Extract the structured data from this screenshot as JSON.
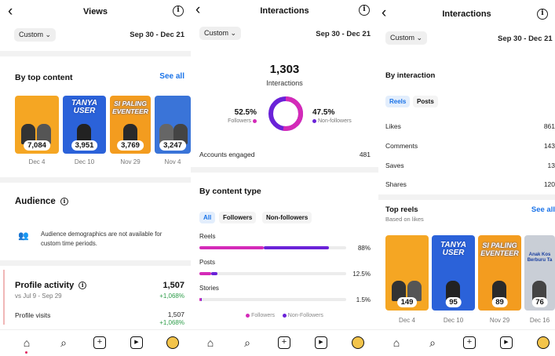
{
  "colors": {
    "followers": "#d42ab8",
    "non_followers": "#6a22d8",
    "accent": "#1a73e8",
    "green": "#2e9d4a"
  },
  "views": {
    "title": "Views",
    "filter": "Custom",
    "date_range": "Sep 30 - Dec 21",
    "top_content": {
      "heading": "By top content",
      "see_all": "See all",
      "items": [
        {
          "count": "7,084",
          "date": "Dec 4"
        },
        {
          "count": "3,951",
          "date": "Dec 10",
          "caption": "TANYA USER"
        },
        {
          "count": "3,769",
          "date": "Nov 29",
          "caption": "SI PALING EVENTEER"
        },
        {
          "count": "3,247",
          "date": "Nov 4"
        }
      ]
    },
    "audience": {
      "heading": "Audience",
      "notice": "Audience demographics are not available for custom time periods."
    },
    "profile_activity": {
      "heading": "Profile activity",
      "sub": "vs Jul 9 - Sep 29",
      "value": "1,507",
      "change": "+1,068%",
      "visits_label": "Profile visits",
      "visits_value": "1,507",
      "visits_change": "+1,068%"
    }
  },
  "interactions": {
    "title": "Interactions",
    "filter": "Custom",
    "date_range": "Sep 30 - Dec 21",
    "total": "1,303",
    "total_label": "Interactions",
    "followers_pct": "52.5%",
    "followers_label": "Followers",
    "non_followers_pct": "47.5%",
    "non_followers_label": "Non-followers",
    "followers_fraction": 0.525,
    "accounts_label": "Accounts engaged",
    "accounts_value": "481",
    "content_type": {
      "heading": "By content type",
      "tabs": [
        "All",
        "Followers",
        "Non-followers"
      ],
      "rows": [
        {
          "label": "Reels",
          "pct": "88%",
          "followers": 0.44,
          "non_followers": 0.44
        },
        {
          "label": "Posts",
          "pct": "12.5%",
          "followers": 0.08,
          "non_followers": 0.045
        },
        {
          "label": "Stories",
          "pct": "1.5%",
          "followers": 0.01,
          "non_followers": 0.005
        }
      ],
      "legend_followers": "Followers",
      "legend_non_followers": "Non-Followers"
    }
  },
  "interactions2": {
    "title": "Interactions",
    "filter": "Custom",
    "date_range": "Sep 30 - Dec 21",
    "by_interaction": {
      "heading": "By interaction",
      "tabs": [
        "Reels",
        "Posts"
      ],
      "rows": [
        {
          "label": "Likes",
          "value": "861"
        },
        {
          "label": "Comments",
          "value": "143"
        },
        {
          "label": "Saves",
          "value": "13"
        },
        {
          "label": "Shares",
          "value": "120"
        }
      ]
    },
    "top_reels": {
      "heading": "Top reels",
      "sub": "Based on likes",
      "see_all": "See all",
      "items": [
        {
          "count": "149",
          "date": "Dec 4"
        },
        {
          "count": "95",
          "date": "Dec 10",
          "caption": "TANYA USER"
        },
        {
          "count": "89",
          "date": "Nov 29",
          "caption": "SI PALING EVENTEER"
        },
        {
          "count": "76",
          "date": "Dec 16",
          "caption": "Anak Kos Berburu Ta"
        }
      ]
    }
  },
  "nav": [
    "home-icon",
    "search-icon",
    "create-icon",
    "reels-icon",
    "profile-icon"
  ]
}
